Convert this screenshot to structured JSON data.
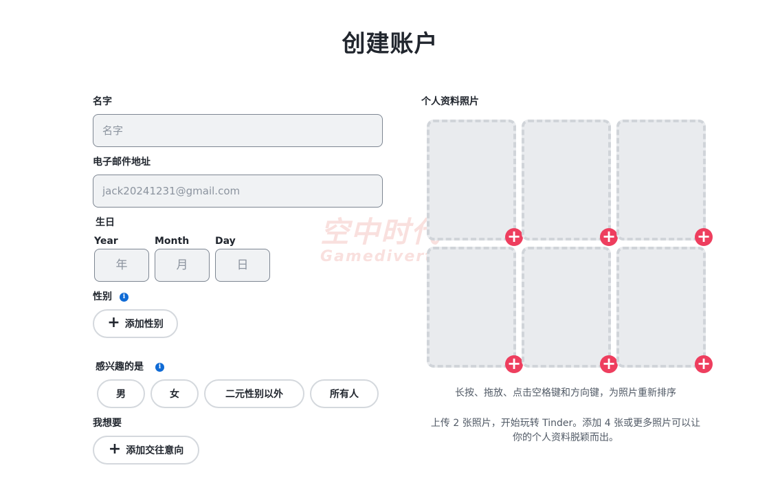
{
  "page": {
    "title": "创建账户"
  },
  "name": {
    "label": "名字",
    "placeholder": "名字"
  },
  "email": {
    "label": "电子邮件地址",
    "value": "jack20241231@gmail.com"
  },
  "birthday": {
    "label": "生日",
    "year": {
      "label": "Year",
      "placeholder": "年"
    },
    "month": {
      "label": "Month",
      "placeholder": "月"
    },
    "day": {
      "label": "Day",
      "placeholder": "日"
    }
  },
  "gender": {
    "label": "性别",
    "add_label": "添加性别"
  },
  "interested": {
    "label": "感兴趣的是",
    "options": [
      "男",
      "女",
      "二元性别以外",
      "所有人"
    ]
  },
  "looking_for": {
    "label": "我想要",
    "add_label": "添加交往意向"
  },
  "photos": {
    "label": "个人资料照片",
    "slot_count": 6,
    "hint": "长按、拖放、点击空格键和方向键，为照片重新排序",
    "upload_text_1": "上传 2 张照片，开始玩转 Tinder。添加 4 张或更多照片可以让",
    "upload_text_2": "你的个人资料脱颖而出。"
  },
  "watermark": {
    "line1": "空中时代",
    "line2": "Gamedivert"
  },
  "colors": {
    "accent": "#ee3e5e",
    "info": "#106bd5",
    "text": "#21262e"
  }
}
